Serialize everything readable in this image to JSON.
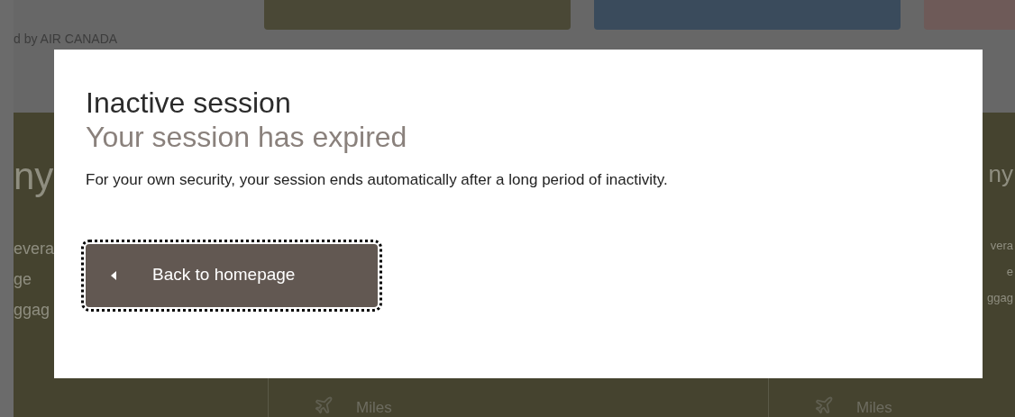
{
  "background": {
    "header_text": "d by AIR CANADA",
    "top_buttons": [
      {
        "color": "#4a4836"
      },
      {
        "color": "#3a4b5c"
      },
      {
        "color": "#6e5a58"
      }
    ],
    "left_column": {
      "heading": "ny",
      "lines": [
        "evera",
        "ge",
        "ggag"
      ]
    },
    "right_column": {
      "heading": "ny",
      "lines": [
        "vera",
        "e",
        "ggag"
      ]
    },
    "bottom_items": [
      {
        "label": "Miles"
      },
      {
        "label": "Miles"
      }
    ]
  },
  "dialog": {
    "title": "Inactive session",
    "subtitle": "Your session has expired",
    "message": "For your own security, your session ends automatically after a long period of inactivity.",
    "button": {
      "label": "Back to homepage",
      "focused": true
    }
  }
}
